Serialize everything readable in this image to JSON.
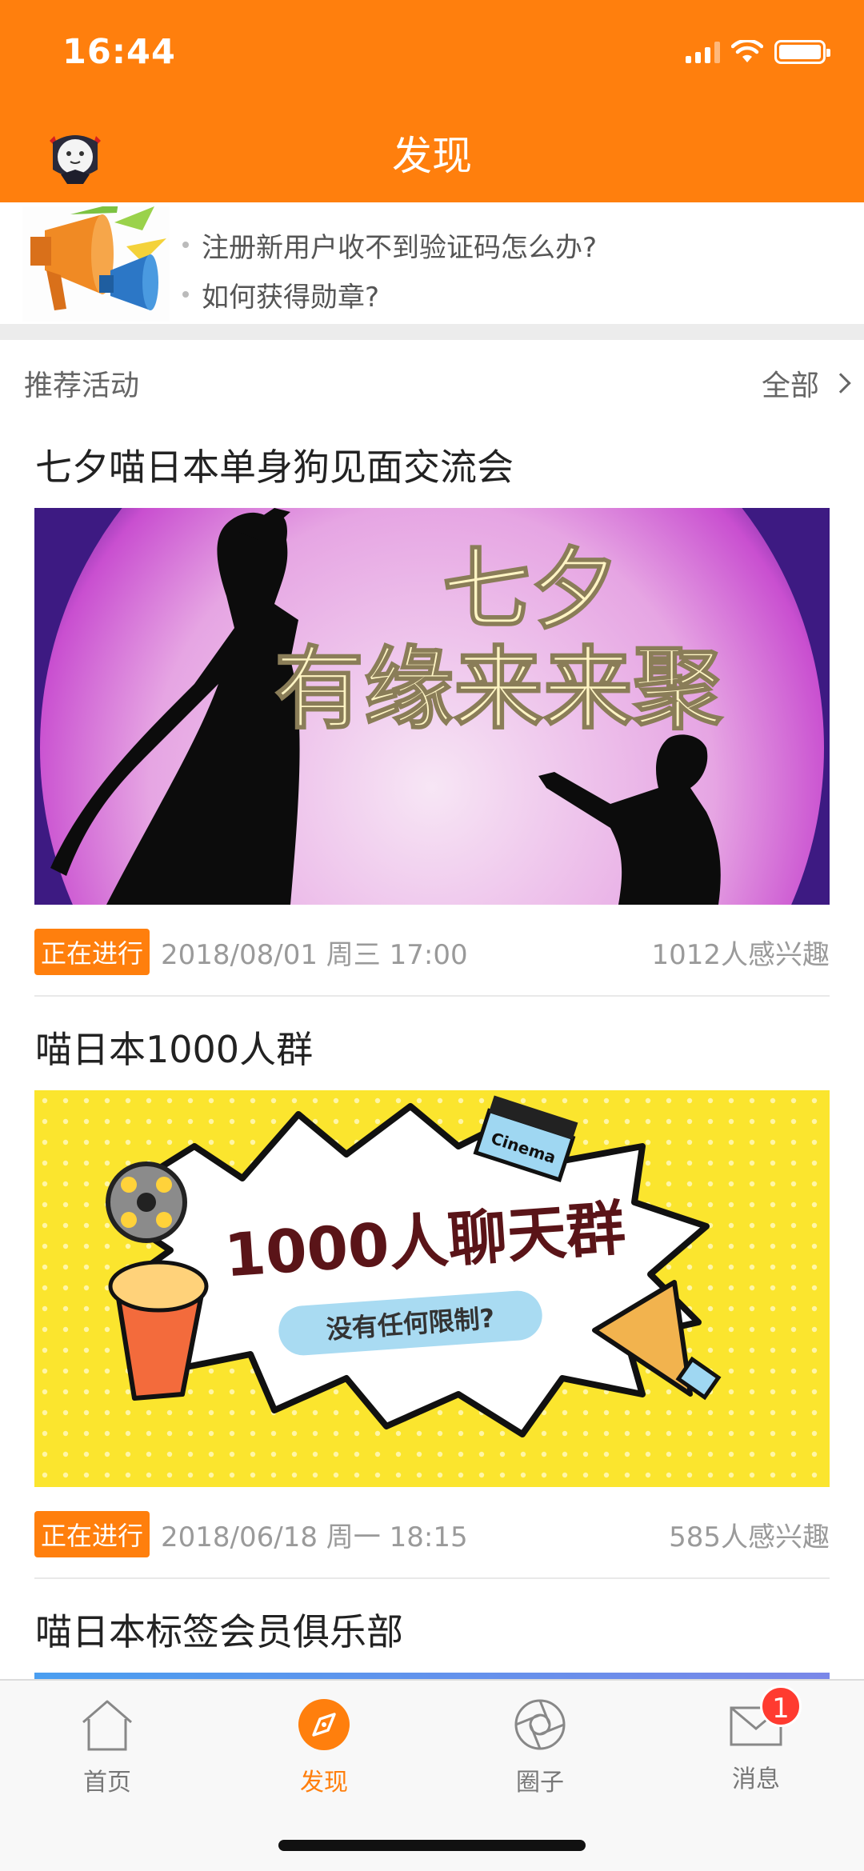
{
  "status_bar": {
    "time": "16:44"
  },
  "header": {
    "title": "发现"
  },
  "notices": [
    {
      "text": "注册新用户收不到验证码怎么办?"
    },
    {
      "text": "如何获得勋章?"
    }
  ],
  "section": {
    "title": "推荐活动",
    "more_label": "全部"
  },
  "activities": [
    {
      "title": "七夕喵日本单身狗见面交流会",
      "banner_text_1": "七夕",
      "banner_text_2": "有缘来来聚",
      "status": "正在进行",
      "date": "2018/08/01 周三 17:00",
      "interest": "1012人感兴趣"
    },
    {
      "title": "喵日本1000人群",
      "banner_text_1": "1000人聊天群",
      "banner_text_2": "没有任何限制?",
      "banner_text_3": "Cinema",
      "status": "正在进行",
      "date": "2018/06/18 周一 18:15",
      "interest": "585人感兴趣"
    },
    {
      "title": "喵日本标签会员俱乐部"
    }
  ],
  "tabbar": {
    "items": [
      {
        "label": "首页",
        "icon": "home-icon"
      },
      {
        "label": "发现",
        "icon": "compass-icon",
        "active": true
      },
      {
        "label": "圈子",
        "icon": "aperture-icon"
      },
      {
        "label": "消息",
        "icon": "mail-icon",
        "badge": "1"
      }
    ]
  },
  "colors": {
    "accent": "#FF7F0D",
    "badge": "#FF3B30"
  }
}
